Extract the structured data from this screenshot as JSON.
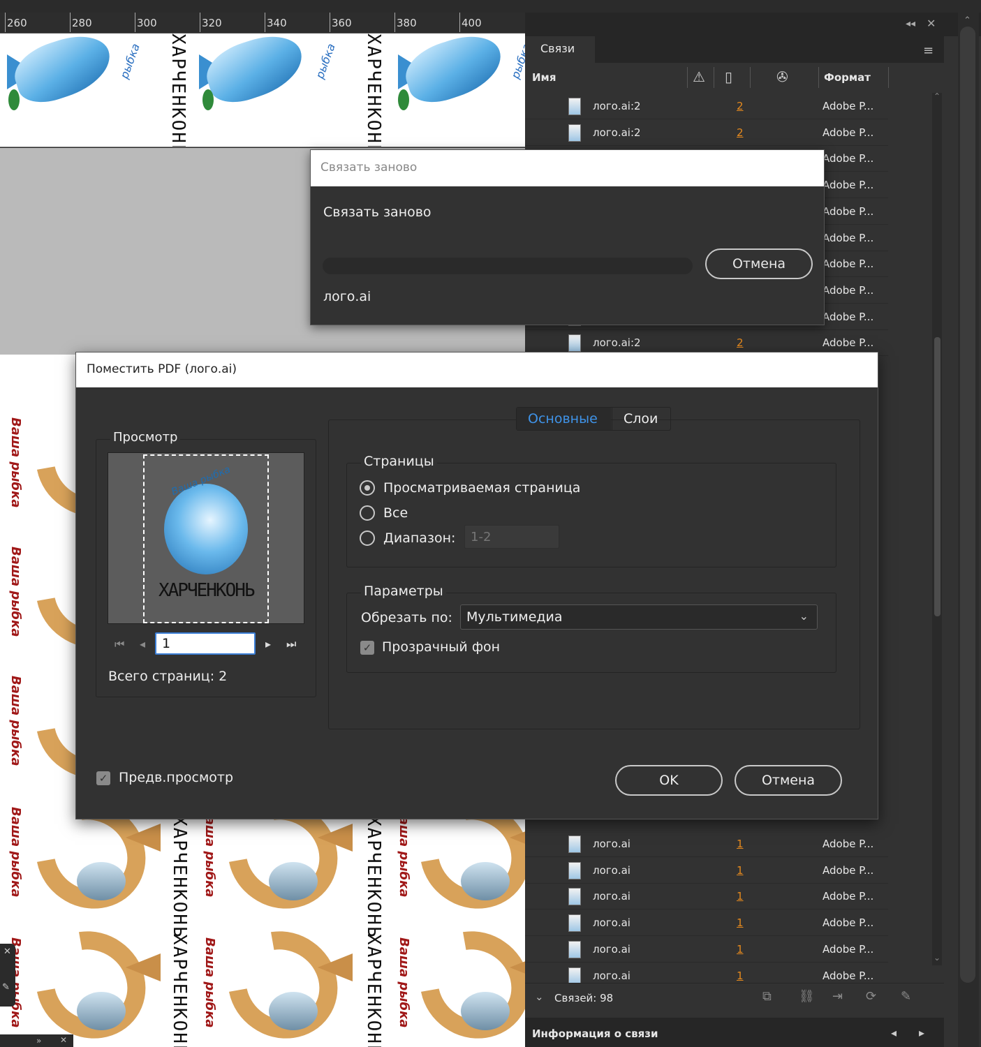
{
  "ruler": {
    "ticks": [
      "260",
      "280",
      "300",
      "320",
      "340",
      "360",
      "380",
      "400"
    ]
  },
  "canvas": {
    "wordmark": "ХАРЧЕНКОНЬ",
    "script_blue": "рыбка",
    "script_red": "Ваша рыбка"
  },
  "links_panel": {
    "tab": "Связи",
    "columns": {
      "name": "Имя",
      "format": "Формат"
    },
    "rows_top": [
      {
        "name": "лого.ai:2",
        "page": "2",
        "format": "Adobe P..."
      },
      {
        "name": "лого.ai:2",
        "page": "2",
        "format": "Adobe P..."
      },
      {
        "name": "",
        "page": "",
        "format": "Adobe P..."
      },
      {
        "name": "",
        "page": "",
        "format": "Adobe P..."
      },
      {
        "name": "",
        "page": "",
        "format": "Adobe P..."
      },
      {
        "name": "",
        "page": "",
        "format": "Adobe P..."
      },
      {
        "name": "",
        "page": "",
        "format": "Adobe P..."
      },
      {
        "name": "",
        "page": "",
        "format": "Adobe P..."
      },
      {
        "name": "",
        "page": "",
        "format": "Adobe P..."
      },
      {
        "name": "лого.ai:2",
        "page": "2",
        "format": "Adobe P..."
      }
    ],
    "rows_bottom": [
      {
        "name": "лого.ai",
        "page": "1",
        "format": "Adobe P..."
      },
      {
        "name": "лого.ai",
        "page": "1",
        "format": "Adobe P..."
      },
      {
        "name": "лого.ai",
        "page": "1",
        "format": "Adobe P..."
      },
      {
        "name": "лого.ai",
        "page": "1",
        "format": "Adobe P..."
      },
      {
        "name": "лого.ai",
        "page": "1",
        "format": "Adobe P..."
      },
      {
        "name": "лого.ai",
        "page": "1",
        "format": "Adobe P..."
      }
    ],
    "footer_count": "Связей: 98",
    "info_title": "Информация о связи"
  },
  "relink_dialog": {
    "title": "Связать заново",
    "heading": "Связать заново",
    "cancel": "Отмена",
    "file": "лого.ai"
  },
  "place_dialog": {
    "title": "Поместить PDF (лого.ai)",
    "preview_label": "Просмотр",
    "page_value": "1",
    "total_pages": "Всего страниц: 2",
    "tabs": [
      "Основные",
      "Слои"
    ],
    "pages_group": "Страницы",
    "radio_current": "Просматриваемая страница",
    "radio_all": "Все",
    "radio_range": "Диапазон:",
    "range_value": "1-2",
    "params_group": "Параметры",
    "crop_label": "Обрезать по:",
    "crop_value": "Мультимедиа",
    "transparent_bg": "Прозрачный фон",
    "show_preview": "Предв.просмотр",
    "ok": "OK",
    "cancel": "Отмена"
  },
  "colors": {
    "accent": "#3f93e8",
    "link_page": "#e68a1e",
    "dialog_bg": "#323232"
  }
}
